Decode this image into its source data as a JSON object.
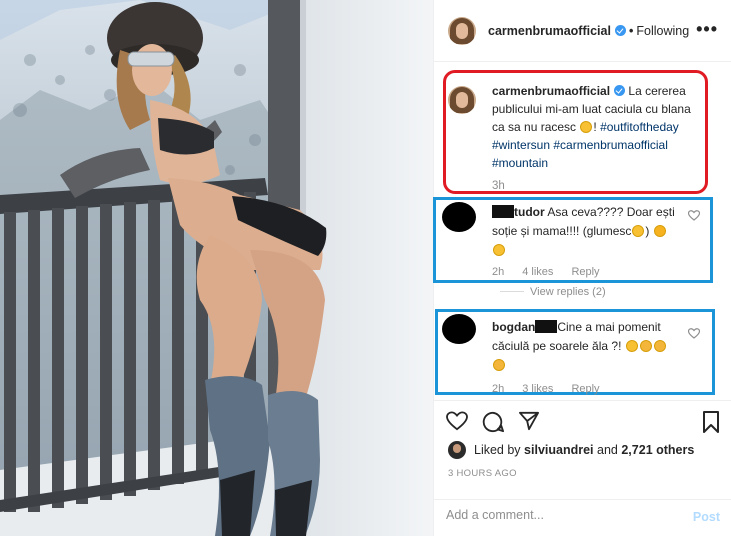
{
  "header": {
    "username": "carmenbrumaofficial",
    "separator": "•",
    "follow_status": "Following",
    "more_icon": "•••"
  },
  "caption": {
    "username": "carmenbrumaofficial",
    "text_line1": "La cererea",
    "text_line2": "publicului mi-am luat caciula cu blana",
    "text_line3": "ca sa nu racesc",
    "text_after_emoji": "!",
    "hashtag1": "#outfitoftheday",
    "hashtag2": "#wintersun",
    "hashtag3": "#carmenbrumaofficial",
    "hashtag4": "#mountain",
    "time": "3h"
  },
  "comments": [
    {
      "username_suffix": "tudor",
      "text_line1": "Asa ceva???? Doar ești",
      "text_line2": "soție și mama!!!! (glumesc",
      "text_line2_end": ")",
      "time": "2h",
      "likes": "4 likes",
      "reply": "Reply"
    },
    {
      "username_prefix": "bogdan",
      "text_line1": "Cine a mai pomenit",
      "text_line2": "căciulă pe soarele ăla ?!",
      "time": "2h",
      "likes": "3 likes",
      "reply": "Reply"
    }
  ],
  "view_replies": "View replies (2)",
  "liked_by": {
    "prefix": "Liked by",
    "user": "silviuandrei",
    "and": "and",
    "others": "2,721 others"
  },
  "time_ago": "3 HOURS AGO",
  "comment_input": {
    "placeholder": "Add a comment..."
  },
  "post_label": "Post",
  "colors": {
    "highlight_red": "#e01b24",
    "highlight_blue": "#1b95d8",
    "link": "#003569",
    "muted": "#8e8e8e"
  }
}
